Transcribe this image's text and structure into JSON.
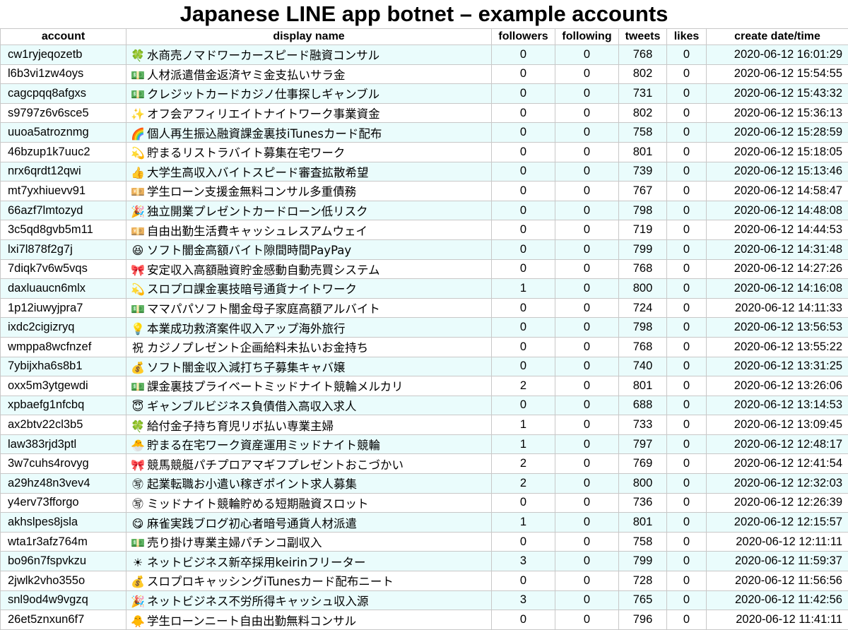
{
  "title": "Japanese LINE app botnet – example accounts",
  "columns": [
    "account",
    "display name",
    "followers",
    "following",
    "tweets",
    "likes",
    "create date/time"
  ],
  "rows": [
    {
      "account": "cw1ryjeqozetb",
      "icon": "four-leaf-clover-icon",
      "glyph": "🍀",
      "name": "水商売ノマドワーカースピード融資コンサル",
      "followers": "0",
      "following": "0",
      "tweets": "768",
      "likes": "0",
      "created": "2020-06-12 16:01:29"
    },
    {
      "account": "l6b3vi1zw4oys",
      "icon": "dollar-banknote-icon",
      "glyph": "💵",
      "name": "人材派遣借金返済ヤミ金支払いサラ金",
      "followers": "0",
      "following": "0",
      "tweets": "802",
      "likes": "0",
      "created": "2020-06-12 15:54:55"
    },
    {
      "account": "cagcpqq8afgxs",
      "icon": "dollar-banknote-icon",
      "glyph": "💵",
      "name": "クレジットカードカジノ仕事探しギャンブル",
      "followers": "0",
      "following": "0",
      "tweets": "731",
      "likes": "0",
      "created": "2020-06-12 15:43:32"
    },
    {
      "account": "s9797z6v6sce5",
      "icon": "sparkles-icon",
      "glyph": "✨",
      "name": "オフ会アフィリエイトナイトワーク事業資金",
      "followers": "0",
      "following": "0",
      "tweets": "802",
      "likes": "0",
      "created": "2020-06-12 15:36:13"
    },
    {
      "account": "uuoa5atroznmg",
      "icon": "rainbow-icon",
      "glyph": "🌈",
      "name": "個人再生振込融資課金裏技iTunesカード配布",
      "followers": "0",
      "following": "0",
      "tweets": "758",
      "likes": "0",
      "created": "2020-06-12 15:28:59"
    },
    {
      "account": "46bzup1k7uuc2",
      "icon": "dizzy-icon",
      "glyph": "💫",
      "name": "貯まるリストラバイト募集在宅ワーク",
      "followers": "0",
      "following": "0",
      "tweets": "801",
      "likes": "0",
      "created": "2020-06-12 15:18:05"
    },
    {
      "account": "nrx6qrdt12qwi",
      "icon": "thumbs-up-icon",
      "glyph": "👍",
      "name": "大学生高収入バイトスピード審査拡散希望",
      "followers": "0",
      "following": "0",
      "tweets": "739",
      "likes": "0",
      "created": "2020-06-12 15:13:46"
    },
    {
      "account": "mt7yxhiuevv91",
      "icon": "yen-banknote-icon",
      "glyph": "💴",
      "name": "学生ローン支援金無料コンサル多重債務",
      "followers": "0",
      "following": "0",
      "tweets": "767",
      "likes": "0",
      "created": "2020-06-12 14:58:47"
    },
    {
      "account": "66azf7lmtozyd",
      "icon": "party-popper-icon",
      "glyph": "🎉",
      "name": "独立開業プレゼントカードローン低リスク",
      "followers": "0",
      "following": "0",
      "tweets": "798",
      "likes": "0",
      "created": "2020-06-12 14:48:08"
    },
    {
      "account": "3c5qd8gvb5m11",
      "icon": "yen-banknote-icon",
      "glyph": "💴",
      "name": "自由出勤生活費キャッシュレスアムウェイ",
      "followers": "0",
      "following": "0",
      "tweets": "719",
      "likes": "0",
      "created": "2020-06-12 14:44:53"
    },
    {
      "account": "lxi7l878f2g7j",
      "icon": "grinning-squinting-face-icon",
      "glyph": "😆",
      "name": "ソフト闇金高額バイト隙間時間PayPay",
      "followers": "0",
      "following": "0",
      "tweets": "799",
      "likes": "0",
      "created": "2020-06-12 14:31:48"
    },
    {
      "account": "7diqk7v6w5vqs",
      "icon": "ribbon-icon",
      "glyph": "🎀",
      "name": "安定収入高額融資貯金感動自動売買システム",
      "followers": "0",
      "following": "0",
      "tweets": "768",
      "likes": "0",
      "created": "2020-06-12 14:27:26"
    },
    {
      "account": "daxluaucn6mlx",
      "icon": "dizzy-icon",
      "glyph": "💫",
      "name": "スロプロ課金裏技暗号通貨ナイトワーク",
      "followers": "1",
      "following": "0",
      "tweets": "800",
      "likes": "0",
      "created": "2020-06-12 14:16:08"
    },
    {
      "account": "1p12iuwyjpra7",
      "icon": "dollar-banknote-icon",
      "glyph": "💵",
      "name": "ママパパソフト闇金母子家庭高額アルバイト",
      "followers": "0",
      "following": "0",
      "tweets": "724",
      "likes": "0",
      "created": "2020-06-12 14:11:33"
    },
    {
      "account": "ixdc2cigizryq",
      "icon": "light-bulb-icon",
      "glyph": "💡",
      "name": "本業成功救済案件収入アップ海外旅行",
      "followers": "0",
      "following": "0",
      "tweets": "798",
      "likes": "0",
      "created": "2020-06-12 13:56:53"
    },
    {
      "account": "wmppa8wcfnzef",
      "icon": "congratulations-ideograph-icon",
      "glyph": "祝",
      "name": "カジノプレゼント企画給料未払いお金持ち",
      "followers": "0",
      "following": "0",
      "tweets": "768",
      "likes": "0",
      "created": "2020-06-12 13:55:22"
    },
    {
      "account": "7ybijxha6s8b1",
      "icon": "money-bag-icon",
      "glyph": "💰",
      "name": "ソフト闇金収入減打ち子募集キャバ嬢",
      "followers": "0",
      "following": "0",
      "tweets": "740",
      "likes": "0",
      "created": "2020-06-12 13:31:25"
    },
    {
      "account": "oxx5m3ytgewdi",
      "icon": "dollar-banknote-icon",
      "glyph": "💵",
      "name": "課金裏技プライベートミッドナイト競輪メルカリ",
      "followers": "2",
      "following": "0",
      "tweets": "801",
      "likes": "0",
      "created": "2020-06-12 13:26:06"
    },
    {
      "account": "xpbaefg1nfcbq",
      "icon": "smiling-face-with-halo-icon",
      "glyph": "😇",
      "name": "ギャンブルビジネス負債借入高収入求人",
      "followers": "0",
      "following": "0",
      "tweets": "688",
      "likes": "0",
      "created": "2020-06-12 13:14:53"
    },
    {
      "account": "ax2btv22cl3b5",
      "icon": "four-leaf-clover-icon",
      "glyph": "🍀",
      "name": "給付金子持ち育児リボ払い専業主婦",
      "followers": "1",
      "following": "0",
      "tweets": "733",
      "likes": "0",
      "created": "2020-06-12 13:09:45"
    },
    {
      "account": "law383rjd3ptl",
      "icon": "hatching-chick-icon",
      "glyph": "🐣",
      "name": "貯まる在宅ワーク資産運用ミッドナイト競輪",
      "followers": "1",
      "following": "0",
      "tweets": "797",
      "likes": "0",
      "created": "2020-06-12 12:48:17"
    },
    {
      "account": "3w7cuhs4rovyg",
      "icon": "ribbon-icon",
      "glyph": "🎀",
      "name": "競馬競艇パチプロアマギフプレゼントおこづかい",
      "followers": "2",
      "following": "0",
      "tweets": "769",
      "likes": "0",
      "created": "2020-06-12 12:41:54"
    },
    {
      "account": "a29hz48n3vev4",
      "icon": "circled-ideograph-advantage-icon",
      "glyph": "㊢",
      "name": "起業転職お小遣い稼ぎポイント求人募集",
      "followers": "2",
      "following": "0",
      "tweets": "800",
      "likes": "0",
      "created": "2020-06-12 12:32:03"
    },
    {
      "account": "y4erv73fforgo",
      "icon": "circled-ideograph-advantage-icon",
      "glyph": "㊢",
      "name": "ミッドナイト競輪貯める短期融資スロット",
      "followers": "0",
      "following": "0",
      "tweets": "736",
      "likes": "0",
      "created": "2020-06-12 12:26:39"
    },
    {
      "account": "akhslpes8jsla",
      "icon": "face-savoring-food-icon",
      "glyph": "😋",
      "name": "麻雀実践ブログ初心者暗号通貨人材派遣",
      "followers": "1",
      "following": "0",
      "tweets": "801",
      "likes": "0",
      "created": "2020-06-12 12:15:57"
    },
    {
      "account": "wta1r3afz764m",
      "icon": "dollar-banknote-icon",
      "glyph": "💵",
      "name": "売り掛け専業主婦パチンコ副収入",
      "followers": "0",
      "following": "0",
      "tweets": "758",
      "likes": "0",
      "created": "2020-06-12 12:11:11"
    },
    {
      "account": "bo96n7fspvkzu",
      "icon": "sun-icon",
      "glyph": "☀",
      "name": "ネットビジネス新卒採用keirinフリーター",
      "followers": "3",
      "following": "0",
      "tweets": "799",
      "likes": "0",
      "created": "2020-06-12 11:59:37"
    },
    {
      "account": "2jwlk2vho355o",
      "icon": "money-bag-icon",
      "glyph": "💰",
      "name": "スロプロキャッシングiTunesカード配布ニート",
      "followers": "0",
      "following": "0",
      "tweets": "728",
      "likes": "0",
      "created": "2020-06-12 11:56:56"
    },
    {
      "account": "snl9od4w9vgzq",
      "icon": "party-popper-icon",
      "glyph": "🎉",
      "name": "ネットビジネス不労所得キャッシュ収入源",
      "followers": "3",
      "following": "0",
      "tweets": "765",
      "likes": "0",
      "created": "2020-06-12 11:42:56"
    },
    {
      "account": "26et5znxun6f7",
      "icon": "front-facing-chick-icon",
      "glyph": "🐥",
      "name": "学生ローンニート自由出勤無料コンサル",
      "followers": "0",
      "following": "0",
      "tweets": "796",
      "likes": "0",
      "created": "2020-06-12 11:41:11"
    }
  ]
}
